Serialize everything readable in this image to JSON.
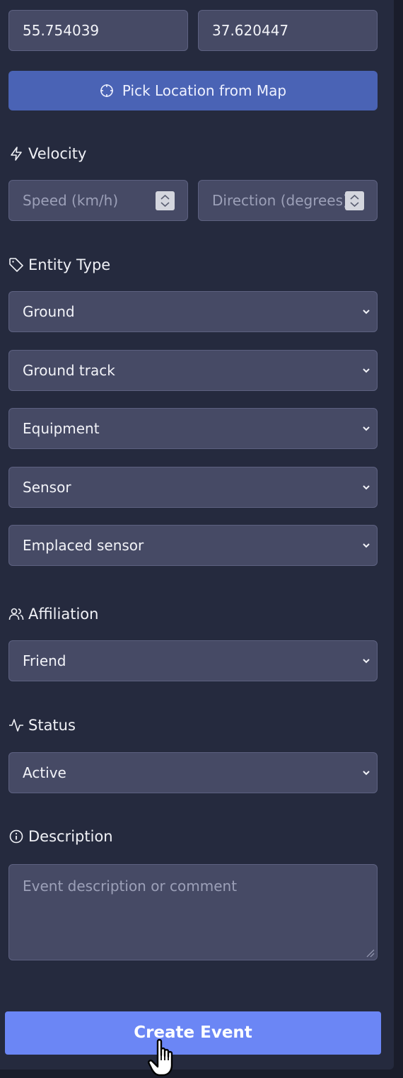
{
  "coordinates": {
    "latitude": "55.754039",
    "longitude": "37.620447"
  },
  "pick_location_button": "Pick Location from Map",
  "velocity": {
    "label": "Velocity",
    "speed_placeholder": "Speed (km/h)",
    "direction_placeholder": "Direction (degrees)"
  },
  "entity_type": {
    "label": "Entity Type",
    "selects": [
      "Ground",
      "Ground track",
      "Equipment",
      "Sensor",
      "Emplaced sensor"
    ]
  },
  "affiliation": {
    "label": "Affiliation",
    "value": "Friend"
  },
  "status": {
    "label": "Status",
    "value": "Active"
  },
  "description": {
    "label": "Description",
    "placeholder": "Event description or comment"
  },
  "create_button": "Create Event",
  "icons": {
    "velocity": "zap-icon",
    "entity_type": "tag-icon",
    "affiliation": "users-icon",
    "status": "activity-icon",
    "description": "info-icon",
    "pick": "crosshair-icon"
  }
}
